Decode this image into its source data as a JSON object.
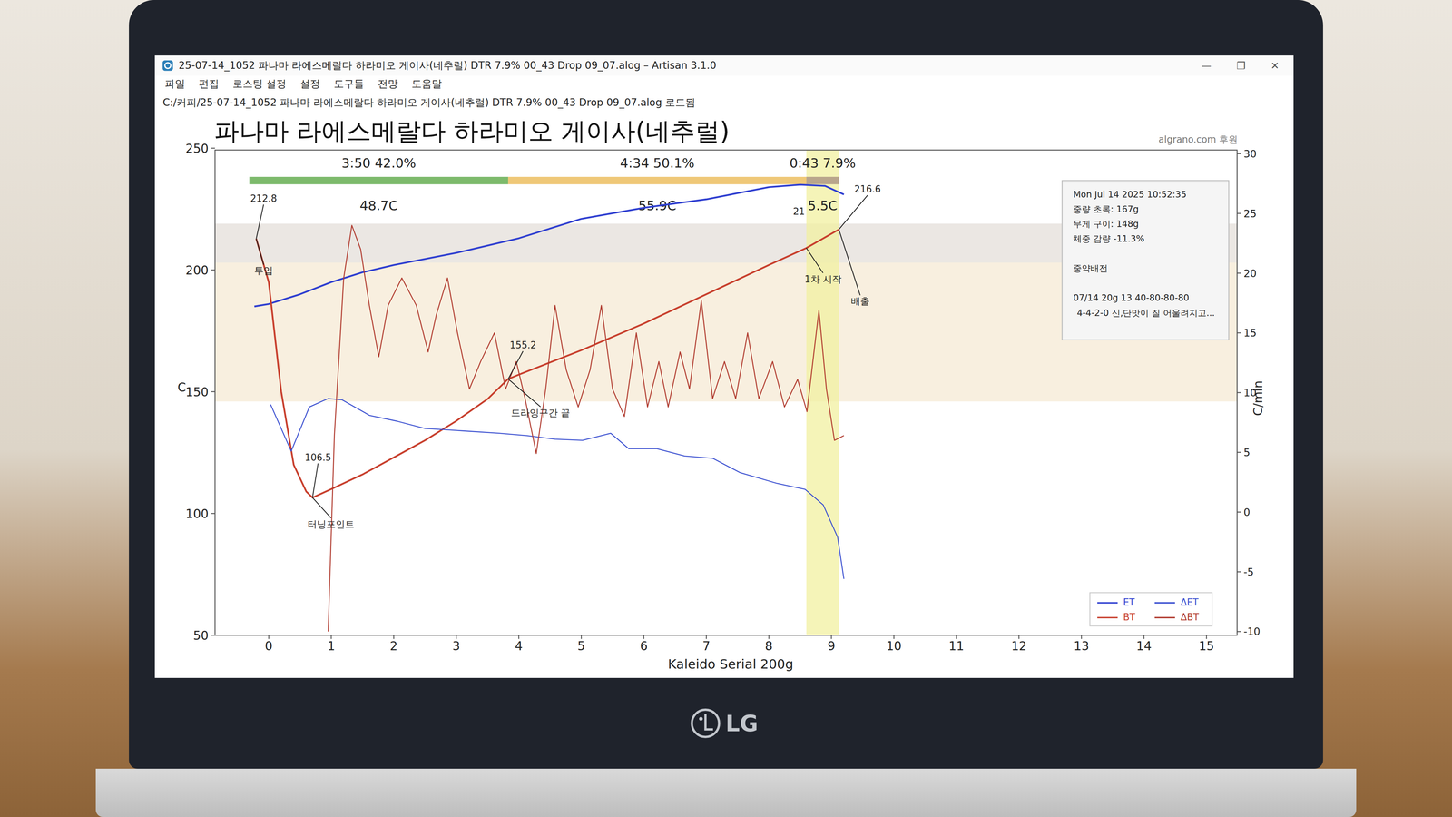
{
  "window": {
    "title": "25-07-14_1052 파나마 라에스메랄다 하라미오 게이사(네추럴) DTR 7.9% 00_43 Drop 09_07.alog – Artisan 3.1.0",
    "controls": [
      "—",
      "❐",
      "✕"
    ]
  },
  "menu": [
    "파일",
    "편집",
    "로스팅 설정",
    "설정",
    "도구들",
    "전망",
    "도움말"
  ],
  "status": "C:/커피/25-07-14_1052 파나마 라에스메랄다 하라미오 게이사(네추럴) DTR 7.9% 00_43 Drop 09_07.alog 로드됨",
  "chart": {
    "title": "파나마 라에스메랄다 하라미오 게이사(네추럴)",
    "sponsor": "algrano.com 후원",
    "temp_axis": {
      "label": "C",
      "ticks": [
        "250",
        "200",
        "150",
        "100",
        "50"
      ]
    },
    "ror_axis": {
      "label": "C/min",
      "ticks": [
        "30",
        "25",
        "20",
        "15",
        "10",
        "5",
        "0",
        "-5",
        "-10"
      ]
    },
    "time_axis": {
      "label": "Kaleido Serial 200g",
      "ticks": [
        "0",
        "1",
        "2",
        "3",
        "4",
        "5",
        "6",
        "7",
        "8",
        "9",
        "10",
        "11",
        "12",
        "13",
        "14",
        "15"
      ]
    },
    "phases": [
      {
        "label": "3:50 42.0%",
        "temp": "48.7C",
        "start": -0.31,
        "end": 3.83,
        "color": "#7dba6c"
      },
      {
        "label": "4:34 50.1%",
        "temp": "55.9C",
        "start": 3.83,
        "end": 8.6,
        "color": "#efc878"
      },
      {
        "label": "0:43 7.9%",
        "temp": "5.5C",
        "start": 8.6,
        "end": 9.12,
        "color": "#b9a68c"
      }
    ],
    "development_band": {
      "start": 8.6,
      "end": 9.12
    },
    "series": [
      {
        "name": "ET",
        "kind": "temp",
        "color": "#2f3fd0",
        "t": [
          -0.23,
          0,
          0.5,
          1,
          1.5,
          2,
          3,
          4,
          5,
          6,
          7,
          8,
          8.5,
          8.9,
          9.2
        ],
        "values": [
          185,
          186,
          190,
          195,
          199,
          202,
          207,
          213,
          221,
          225.5,
          229,
          234,
          235,
          234.5,
          231
        ]
      },
      {
        "name": "BT",
        "kind": "temp",
        "color": "#c8402e",
        "t": [
          -0.2,
          0,
          0.2,
          0.4,
          0.6,
          0.7,
          1,
          1.5,
          2,
          2.5,
          3,
          3.5,
          3.83,
          4,
          5,
          6,
          7,
          8,
          8.6,
          9.12
        ],
        "values": [
          212.8,
          195,
          150,
          120,
          109,
          106.5,
          110,
          116,
          123,
          130,
          138,
          147,
          155.2,
          157,
          167,
          178,
          190,
          202,
          209,
          216.6
        ]
      },
      {
        "name": "ΔET",
        "kind": "ror",
        "color": "#3a4fd0",
        "t": [
          0.03,
          0.36,
          0.65,
          0.95,
          1.17,
          1.61,
          2.06,
          2.5,
          3.1,
          3.69,
          4.13,
          4.58,
          5.02,
          5.47,
          5.76,
          6.21,
          6.65,
          7.1,
          7.54,
          8.13,
          8.58,
          8.87,
          9.1,
          9.2
        ],
        "values": [
          9,
          5.1,
          8.8,
          9.5,
          9.4,
          8.1,
          7.6,
          7,
          6.8,
          6.6,
          6.4,
          6.1,
          6,
          6.6,
          5.3,
          5.3,
          4.7,
          4.5,
          3.3,
          2.4,
          1.9,
          0.6,
          -2.1,
          -5.6
        ]
      },
      {
        "name": "ΔBT",
        "kind": "ror",
        "color": "#b03a2e",
        "t": [
          0.95,
          1.05,
          1.2,
          1.33,
          1.47,
          1.61,
          1.76,
          1.91,
          2.13,
          2.36,
          2.55,
          2.68,
          2.86,
          3.02,
          3.21,
          3.39,
          3.61,
          3.79,
          3.96,
          4.1,
          4.28,
          4.43,
          4.58,
          4.76,
          4.95,
          5.14,
          5.32,
          5.5,
          5.69,
          5.88,
          6.06,
          6.24,
          6.39,
          6.58,
          6.73,
          6.92,
          7.1,
          7.29,
          7.47,
          7.66,
          7.84,
          8.06,
          8.25,
          8.46,
          8.61,
          8.8,
          8.92,
          9.05,
          9.2
        ],
        "values": [
          -10,
          6.4,
          19.6,
          24,
          22,
          17.3,
          13,
          17.3,
          19.6,
          17.3,
          13.4,
          16.5,
          19.6,
          15,
          10.3,
          12.6,
          15,
          10.3,
          12.6,
          9.5,
          4.9,
          10.3,
          17.3,
          11.9,
          8.8,
          11.9,
          17.3,
          10.3,
          8,
          15,
          8.8,
          12.6,
          8.8,
          13.4,
          10.3,
          17.7,
          9.5,
          12.6,
          9.5,
          15,
          9.5,
          12.6,
          8.8,
          11.1,
          8.4,
          16.9,
          10.3,
          6,
          6.4
        ]
      }
    ],
    "annotations": [
      {
        "label": "212.8",
        "t": -0.2,
        "value": 212.8,
        "leader": true
      },
      {
        "label": "투입",
        "t": -0.2,
        "value": 212.8,
        "leader": true
      },
      {
        "label": "106.5",
        "t": 0.7,
        "value": 106.5,
        "leader": true
      },
      {
        "label": "터닝포인트",
        "t": 0.7,
        "value": 106.5,
        "leader": true
      },
      {
        "label": "155.2",
        "t": 3.83,
        "value": 155.2,
        "leader": true
      },
      {
        "label": "드라잉구간 끝",
        "t": 3.83,
        "value": 155.2,
        "leader": true
      },
      {
        "label": "1차 시작",
        "t": 8.6,
        "value": 209,
        "leader": true
      },
      {
        "label": "21",
        "t": 8.6,
        "value": 209,
        "leader": false
      },
      {
        "label": "배출",
        "t": 9.12,
        "value": 216.6,
        "leader": true
      },
      {
        "label": "216.6",
        "t": 9.12,
        "value": 216.6,
        "leader": true
      }
    ],
    "info": [
      [
        "Mon Jul 14 2025 10:52:35",
        "중량 초록: 167g",
        "무게 구이: 148g",
        "체중 감량 -11.3%"
      ],
      [
        "중약배전"
      ],
      [
        "07/14 20g 13 40-80-80-80",
        "4-4-2-0 신,단맛이 질 어울려지고..."
      ]
    ]
  },
  "laptop": {
    "logo": "LG"
  }
}
